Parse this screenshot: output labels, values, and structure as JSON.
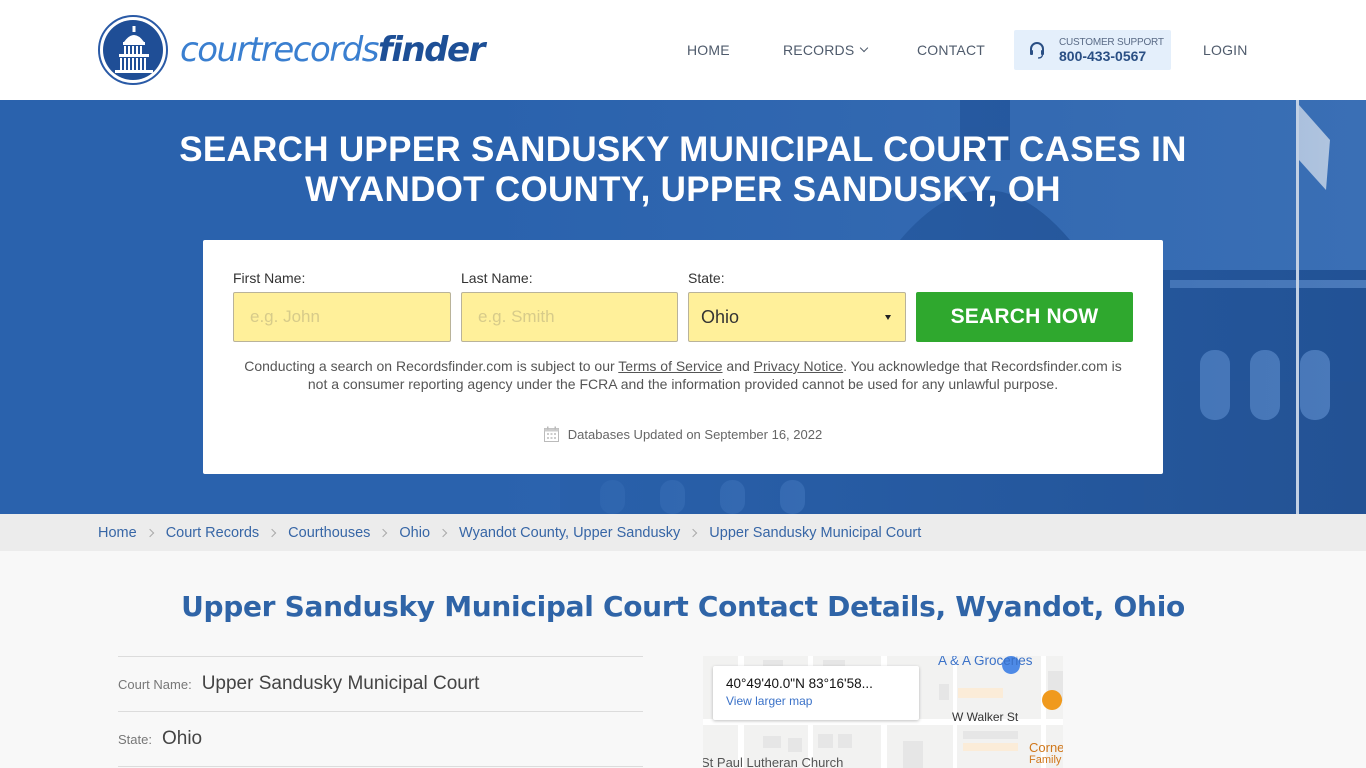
{
  "header": {
    "logo": {
      "text_light": "courtrecords",
      "text_bold": "finder"
    },
    "nav": {
      "home": "HOME",
      "records": "RECORDS",
      "contact": "CONTACT",
      "support_label": "CUSTOMER SUPPORT",
      "support_phone": "800-433-0567",
      "login": "LOGIN"
    }
  },
  "hero": {
    "title_line1": "SEARCH UPPER SANDUSKY MUNICIPAL COURT CASES IN",
    "title_line2": "WYANDOT COUNTY, UPPER SANDUSKY, OH",
    "form": {
      "first_name_label": "First Name:",
      "first_name_placeholder": "e.g. John",
      "first_name_value": "",
      "last_name_label": "Last Name:",
      "last_name_placeholder": "e.g. Smith",
      "last_name_value": "",
      "state_label": "State:",
      "state_value": "Ohio",
      "search_button": "SEARCH NOW"
    },
    "disclaimer": {
      "part1": "Conducting a search on Recordsfinder.com is subject to our ",
      "terms_link": "Terms of Service",
      "part2": " and ",
      "privacy_link": "Privacy Notice",
      "part3": ". You acknowledge that Recordsfinder.com is not a consumer reporting agency under the FCRA and the information provided cannot be used for any unlawful purpose."
    },
    "db_updated": "Databases Updated on September 16, 2022"
  },
  "breadcrumb": [
    "Home",
    "Court Records",
    "Courthouses",
    "Ohio",
    "Wyandot County, Upper Sandusky",
    "Upper Sandusky Municipal Court"
  ],
  "main": {
    "title": "Upper Sandusky Municipal Court Contact Details, Wyandot, Ohio",
    "details": [
      {
        "label": "Court Name:",
        "value": "Upper Sandusky Municipal Court"
      },
      {
        "label": "State:",
        "value": "Ohio"
      }
    ],
    "map": {
      "coords": "40°49'40.0\"N 83°16'58...",
      "view_larger": "View larger map",
      "poi_groceries": "A & A Groceries",
      "street_walker": "W Walker St",
      "poi_church": "St Paul Lutheran Church",
      "poi_corner": "Corne",
      "poi_family": "Family"
    }
  },
  "colors": {
    "brand_blue": "#1d4f96",
    "hero_blue": "#2a62ad",
    "search_green": "#2fa82e",
    "input_yellow": "#fff09a",
    "link_blue": "#3766a6"
  }
}
